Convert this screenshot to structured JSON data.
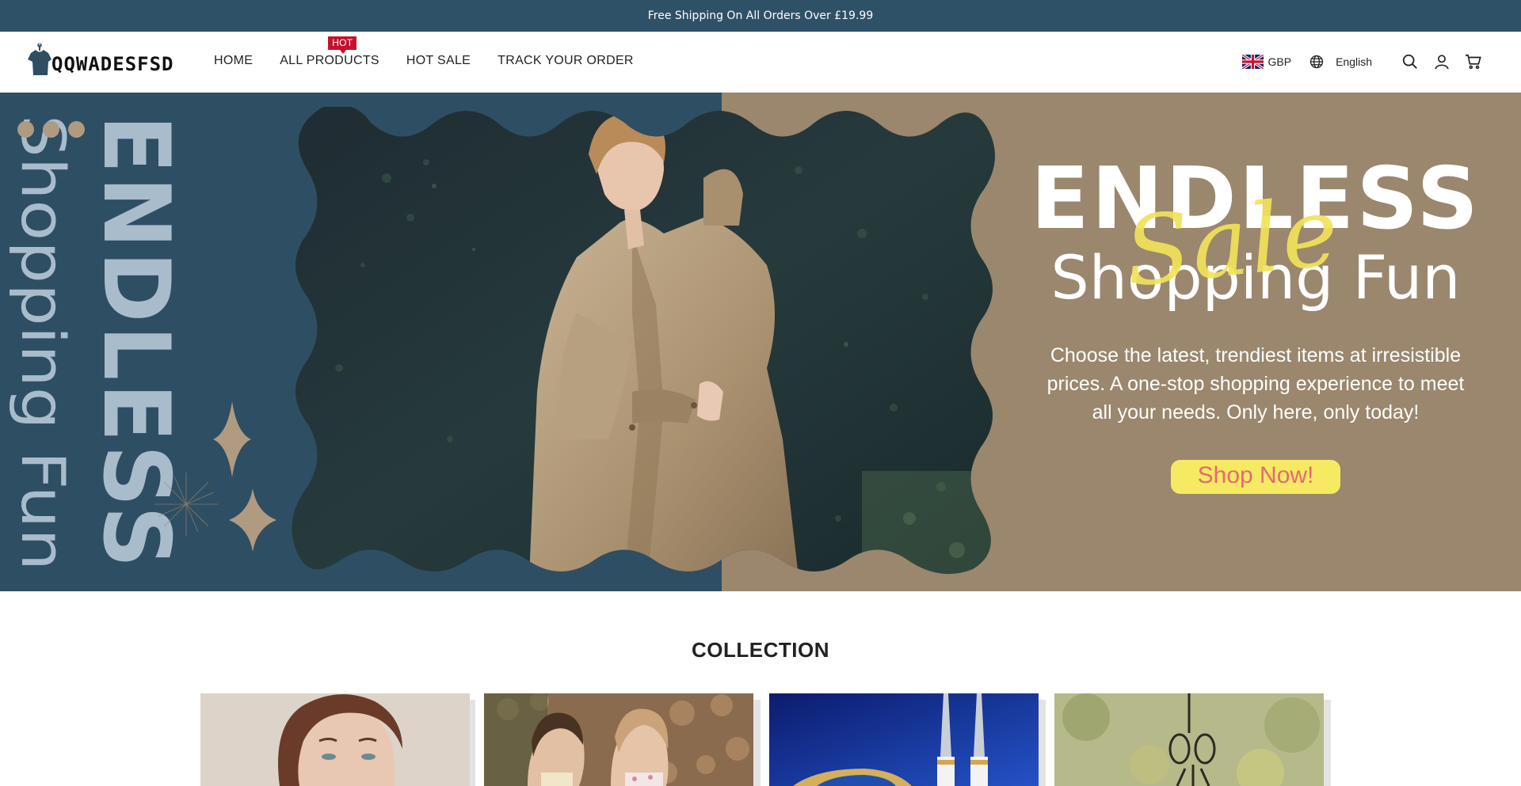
{
  "announcement": {
    "text": "Free Shipping On All Orders Over £19.99"
  },
  "brand": {
    "name": "QQWADESFSD"
  },
  "nav": {
    "items": [
      {
        "label": "HOME"
      },
      {
        "label": "ALL PRODUCTS",
        "badge": "HOT"
      },
      {
        "label": "HOT SALE"
      },
      {
        "label": "TRACK YOUR ORDER"
      }
    ]
  },
  "header": {
    "currency": "GBP",
    "language": "English",
    "icons": [
      "globe-icon",
      "search-icon",
      "account-icon",
      "cart-icon"
    ]
  },
  "hero": {
    "vertical_big": "ENDLESS",
    "vertical_small": "Shopping Fun",
    "title_line1": "ENDLESS",
    "title_script": "Sale",
    "title_line2": "Shopping Fun",
    "description": "Choose the latest, trendiest items at irresistible prices. A one-stop shopping experience to meet all your needs. Only here, only today!",
    "cta": "Shop Now!",
    "colors": {
      "left_bg": "#2e4e63",
      "right_bg": "#9a876d",
      "accent": "#f6ea63",
      "cta_text": "#e46a74"
    }
  },
  "collection": {
    "title": "COLLECTION",
    "cards": [
      {
        "name": "woman-portrait"
      },
      {
        "name": "swimwear-models"
      },
      {
        "name": "tools-blue"
      },
      {
        "name": "garden-hook"
      }
    ]
  },
  "colors": {
    "announcement_bg": "#2f5168",
    "hot_badge": "#c8102e"
  }
}
